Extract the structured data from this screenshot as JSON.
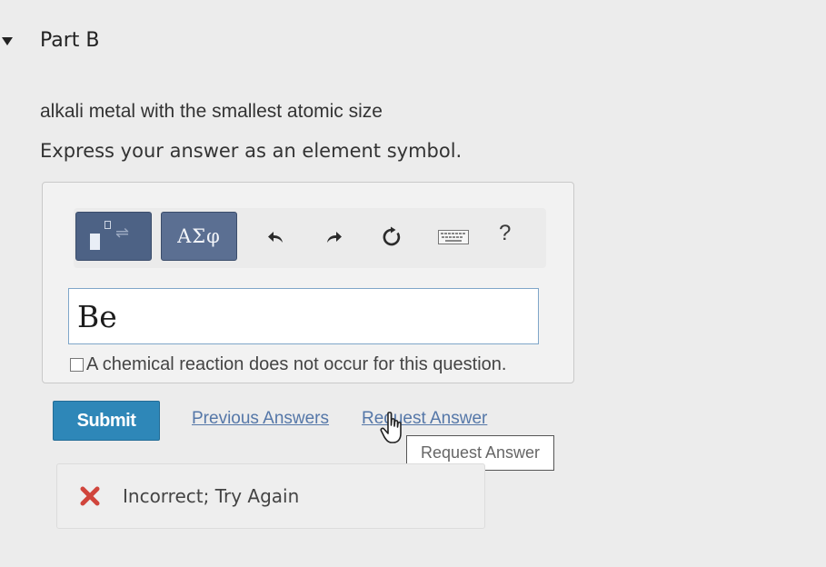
{
  "part": {
    "title": "Part B"
  },
  "question": {
    "prompt": "alkali metal with the smallest atomic size",
    "instruction": "Express your answer as an element symbol."
  },
  "toolbar": {
    "template_icon": "templates-icon",
    "greek_label": "ΑΣφ",
    "undo_icon": "undo-icon",
    "redo_icon": "redo-icon",
    "reset_icon": "reset-icon",
    "keyboard_icon": "keyboard-icon",
    "help_label": "?"
  },
  "answer": {
    "value": "Be"
  },
  "no_reaction": {
    "checked": false,
    "label": "A chemical reaction does not occur for this question."
  },
  "actions": {
    "submit_label": "Submit",
    "previous_answers_label": "Previous Answers",
    "request_answer_label": "Request Answer",
    "tooltip": "Request Answer"
  },
  "feedback": {
    "status_icon": "x-icon",
    "message": "Incorrect; Try Again",
    "status_color": "#d0453c"
  },
  "colors": {
    "submit": "#2e87b8",
    "toolbar_button": "#4d6285",
    "link": "#5577a8"
  }
}
